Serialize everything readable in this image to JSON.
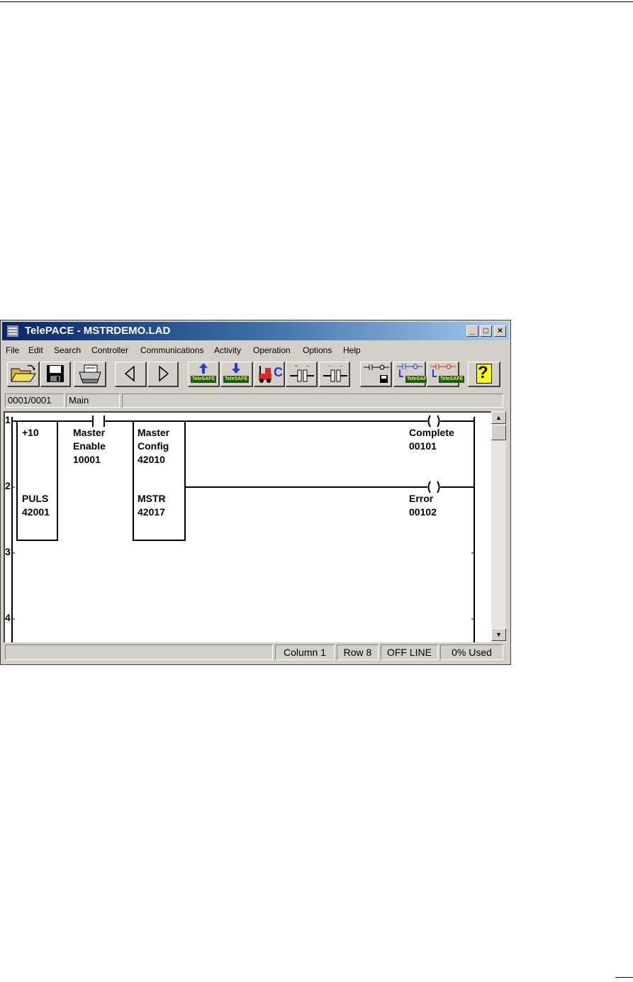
{
  "window": {
    "title": "TelePACE - MSTRDEMO.LAD",
    "controls": {
      "minimize": "_",
      "maximize": "□",
      "close": "×"
    }
  },
  "menu": [
    "File",
    "Edit",
    "Search",
    "Controller",
    "Communications",
    "Activity",
    "Operation",
    "Options",
    "Help"
  ],
  "toolbar": {
    "buttons": [
      {
        "name": "open-icon"
      },
      {
        "name": "save-icon"
      },
      {
        "name": "print-icon"
      },
      {
        "name": "previous-icon"
      },
      {
        "name": "next-icon"
      },
      {
        "name": "write-to-controller-icon",
        "label": "TeleSAFE"
      },
      {
        "name": "read-from-controller-icon",
        "label": "TeleSAFE"
      },
      {
        "name": "c-program-icon",
        "label": "C"
      },
      {
        "name": "insert-element-icon"
      },
      {
        "name": "delete-element-icon"
      },
      {
        "name": "save-ladder-icon"
      },
      {
        "name": "write-ladder-icon",
        "label": "TeleSAFE"
      },
      {
        "name": "read-ladder-icon",
        "label": "TeleSAFE"
      },
      {
        "name": "help-icon",
        "label": "?"
      }
    ]
  },
  "pathbar": {
    "network": "0001/0001",
    "program": "Main",
    "comment": ""
  },
  "ladder": {
    "rows": [
      "1",
      "2",
      "3",
      "4"
    ],
    "pulse_block": {
      "top": "+10",
      "function": "PULS",
      "register": "42001"
    },
    "contact": {
      "line1": "Master",
      "line2": "Enable",
      "address": "10001"
    },
    "mstr_block": {
      "top_line1": "Master",
      "top_line2": "Config",
      "top_register": "42010",
      "function": "MSTR",
      "register": "42017"
    },
    "coil_complete": {
      "label": "Complete",
      "address": "00101"
    },
    "coil_error": {
      "label": "Error",
      "address": "00102"
    }
  },
  "status": {
    "message": "",
    "column": "Column 1",
    "row": "Row 8",
    "mode": "OFF LINE",
    "used": "0% Used"
  }
}
